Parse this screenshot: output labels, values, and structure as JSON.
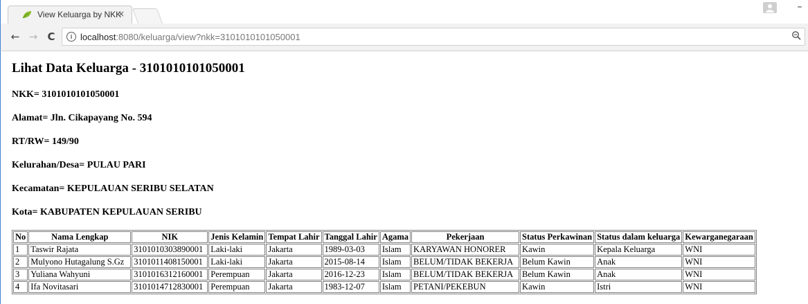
{
  "browser": {
    "tab_title": "View Keluarga by NKK",
    "tab_close_glyph": "×",
    "url_host": "localhost",
    "url_rest": ":8080/keluarga/view?nkk=3101010101050001",
    "icons": {
      "tab_favicon": "leaf-icon",
      "back": "arrow-left-icon",
      "forward": "arrow-right-icon",
      "reload": "reload-icon",
      "site_info": "info-icon",
      "zoom": "zoom-icon",
      "profile": "profile-icon",
      "minimize": "minimize-icon"
    },
    "colors": {
      "frame_accent": "#3f7fd0",
      "favicon": "#8bbf2f"
    }
  },
  "page": {
    "title": "Lihat Data Keluarga - 3101010101050001",
    "fields": {
      "nkk": "NKK= 3101010101050001",
      "alamat": "Alamat= Jln. Cikapayang No. 594",
      "rtrw": "RT/RW= 149/90",
      "kelurahan": "Kelurahan/Desa= PULAU PARI",
      "kecamatan": "Kecamatan= KEPULAUAN SERIBU SELATAN",
      "kota": "Kota= KABUPATEN KEPULAUAN SERIBU"
    },
    "table": {
      "headers": [
        "No",
        "Nama Lengkap",
        "NIK",
        "Jenis Kelamin",
        "Tempat Lahir",
        "Tanggal Lahir",
        "Agama",
        "Pekerjaan",
        "Status Perkawinan",
        "Status dalam keluarga",
        "Kewarganegaraan"
      ],
      "rows": [
        [
          "1",
          "Taswir Rajata",
          "3101010303890001",
          "Laki-laki",
          "Jakarta",
          "1989-03-03",
          "Islam",
          "KARYAWAN HONORER",
          "Kawin",
          "Kepala Keluarga",
          "WNI"
        ],
        [
          "2",
          "Mulyono Hutagalung S.Gz",
          "3101011408150001",
          "Laki-laki",
          "Jakarta",
          "2015-08-14",
          "Islam",
          "BELUM/TIDAK BEKERJA",
          "Belum Kawin",
          "Anak",
          "WNI"
        ],
        [
          "3",
          "Yuliana Wahyuni",
          "3101016312160001",
          "Perempuan",
          "Jakarta",
          "2016-12-23",
          "Islam",
          "BELUM/TIDAK BEKERJA",
          "Belum Kawin",
          "Anak",
          "WNI"
        ],
        [
          "4",
          "Ifa Novitasari",
          "3101014712830001",
          "Perempuan",
          "Jakarta",
          "1983-12-07",
          "Islam",
          "PETANI/PEKEBUN",
          "Kawin",
          "Istri",
          "WNI"
        ]
      ]
    }
  }
}
